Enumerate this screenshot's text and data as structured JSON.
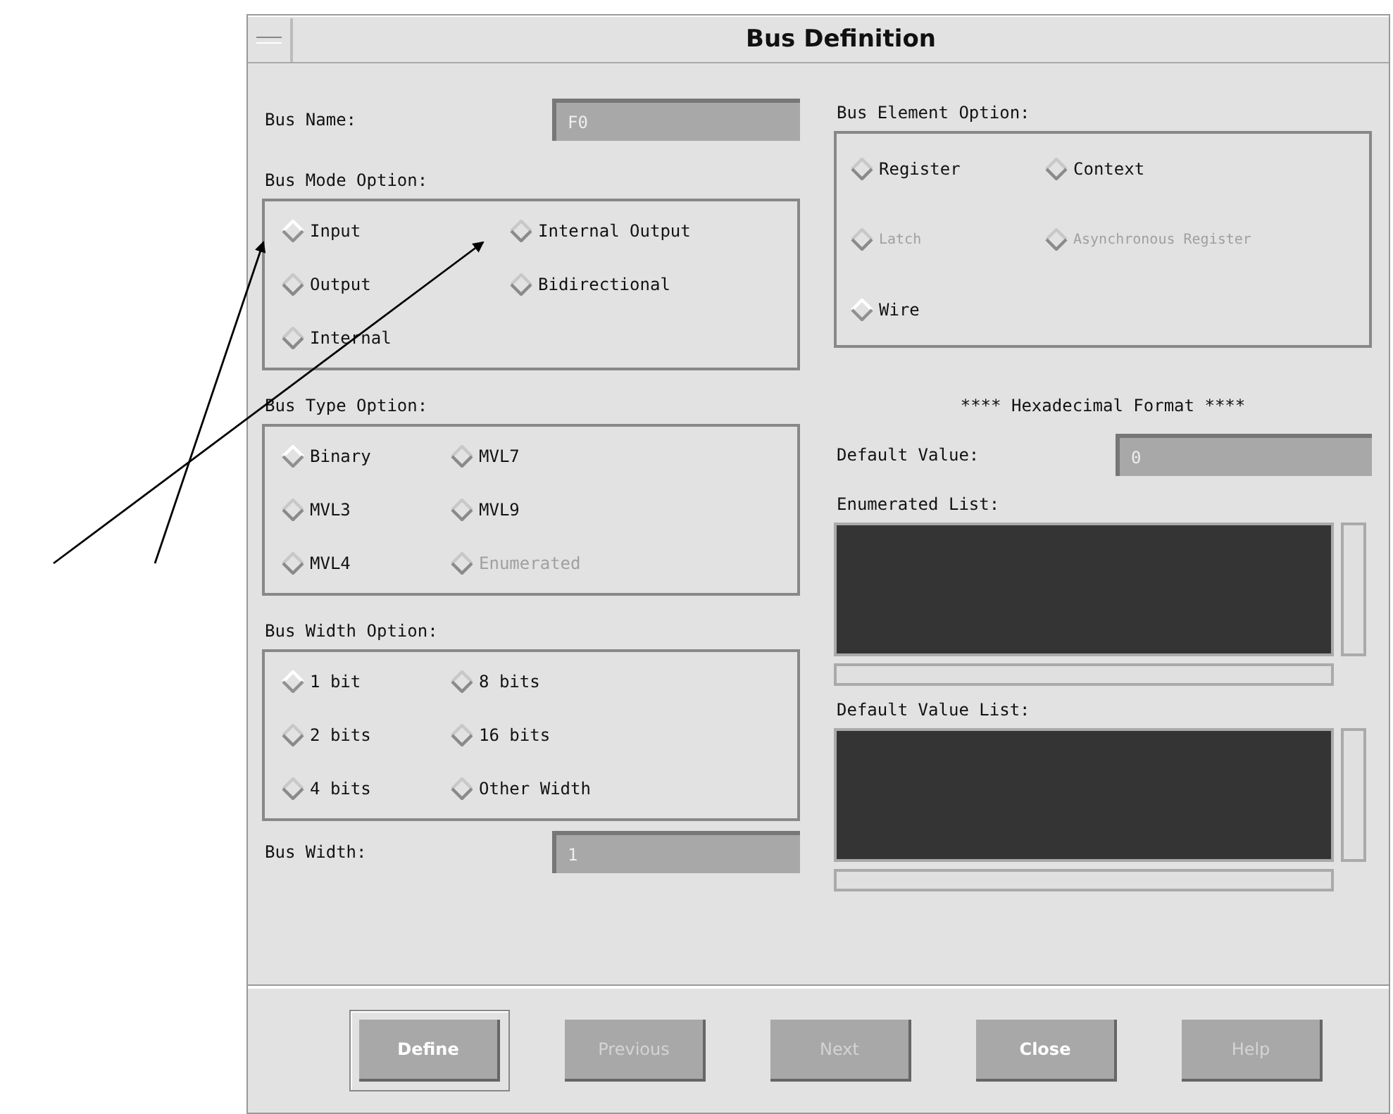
{
  "window": {
    "title": "Bus Definition"
  },
  "bus_name": {
    "label": "Bus Name:",
    "value": "F0"
  },
  "left_groups": [
    {
      "label": "Bus Mode Option:",
      "col2": true,
      "options": [
        {
          "label": "Input",
          "selected": true,
          "disabled": false
        },
        {
          "label": "Internal Output",
          "selected": false,
          "disabled": false
        },
        {
          "label": "Output",
          "selected": false,
          "disabled": false
        },
        {
          "label": "Bidirectional",
          "selected": false,
          "disabled": false
        },
        {
          "label": "Internal",
          "selected": false,
          "disabled": false
        }
      ]
    },
    {
      "label": "Bus Type Option:",
      "col2": false,
      "options": [
        {
          "label": "Binary",
          "selected": true,
          "disabled": false
        },
        {
          "label": "MVL7",
          "selected": false,
          "disabled": false
        },
        {
          "label": "MVL3",
          "selected": false,
          "disabled": false
        },
        {
          "label": "MVL9",
          "selected": false,
          "disabled": false
        },
        {
          "label": "MVL4",
          "selected": false,
          "disabled": false
        },
        {
          "label": "Enumerated",
          "selected": false,
          "disabled": true
        }
      ]
    },
    {
      "label": "Bus Width Option:",
      "col2": false,
      "options": [
        {
          "label": "1 bit",
          "selected": true,
          "disabled": false
        },
        {
          "label": "8 bits",
          "selected": false,
          "disabled": false
        },
        {
          "label": "2 bits",
          "selected": false,
          "disabled": false
        },
        {
          "label": "16 bits",
          "selected": false,
          "disabled": false
        },
        {
          "label": "4 bits",
          "selected": false,
          "disabled": false
        },
        {
          "label": "Other Width",
          "selected": false,
          "disabled": false
        }
      ]
    }
  ],
  "bus_width": {
    "label": "Bus Width:",
    "value": "1"
  },
  "element_group": {
    "label": "Bus Element Option:",
    "options": [
      {
        "label": "Register",
        "selected": false,
        "disabled": false
      },
      {
        "label": "Context",
        "selected": false,
        "disabled": false
      },
      {
        "label": "Latch",
        "selected": false,
        "disabled": true
      },
      {
        "label": "Asynchronous Register",
        "selected": false,
        "disabled": true
      },
      {
        "label": "Wire",
        "selected": true,
        "disabled": false
      }
    ]
  },
  "format_note": "**** Hexadecimal Format ****",
  "default_value": {
    "label": "Default Value:",
    "value": "0"
  },
  "lists": [
    {
      "label": "Enumerated List:"
    },
    {
      "label": "Default Value List:"
    }
  ],
  "buttons": [
    {
      "label": "Define",
      "disabled": false,
      "default": true
    },
    {
      "label": "Previous",
      "disabled": true,
      "default": false
    },
    {
      "label": "Next",
      "disabled": true,
      "default": false
    },
    {
      "label": "Close",
      "disabled": false,
      "default": false
    },
    {
      "label": "Help",
      "disabled": true,
      "default": false
    }
  ]
}
